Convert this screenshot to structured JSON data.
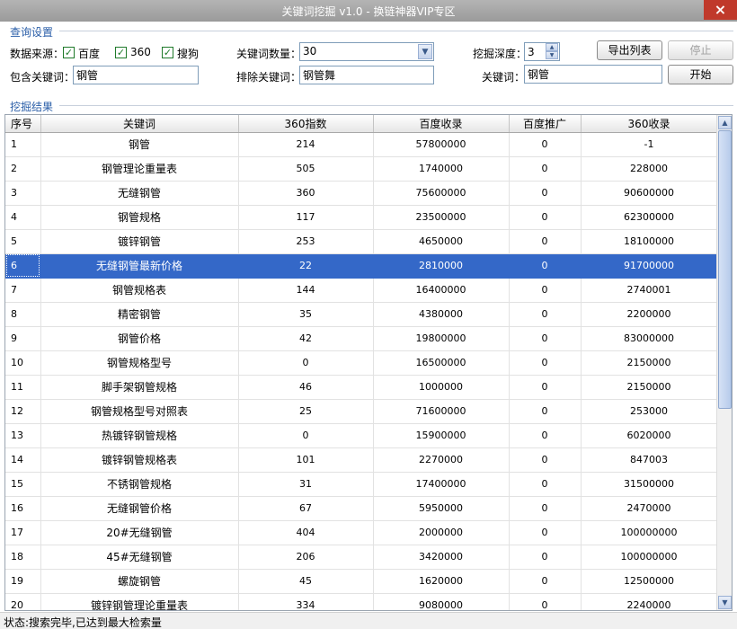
{
  "window": {
    "title": "关键词挖掘 v1.0 - 换链神器VIP专区",
    "close_glyph": "×"
  },
  "query": {
    "section_label": "查询设置",
    "source_label": "数据来源：",
    "sources": [
      {
        "label": "百度",
        "checked": true
      },
      {
        "label": "360",
        "checked": true
      },
      {
        "label": "搜狗",
        "checked": true
      }
    ],
    "check_glyph": "✓",
    "count_label": "关键词数量：",
    "count_value": "30",
    "depth_label": "挖掘深度：",
    "depth_value": "3",
    "include_label": "包含关键词：",
    "include_value": "钢管",
    "exclude_label": "排除关键词：",
    "exclude_value": "钢管舞",
    "keyword_label": "关键词：",
    "keyword_value": "钢管",
    "export_button": "导出列表",
    "stop_button": "停止",
    "start_button": "开始"
  },
  "results": {
    "section_label": "挖掘结果",
    "columns": [
      "序号",
      "关键词",
      "360指数",
      "百度收录",
      "百度推广",
      "360收录"
    ],
    "selected_index": 5,
    "rows": [
      [
        "1",
        "钢管",
        "214",
        "57800000",
        "0",
        "-1"
      ],
      [
        "2",
        "钢管理论重量表",
        "505",
        "1740000",
        "0",
        "228000"
      ],
      [
        "3",
        "无缝钢管",
        "360",
        "75600000",
        "0",
        "90600000"
      ],
      [
        "4",
        "钢管规格",
        "117",
        "23500000",
        "0",
        "62300000"
      ],
      [
        "5",
        "镀锌钢管",
        "253",
        "4650000",
        "0",
        "18100000"
      ],
      [
        "6",
        "无缝钢管最新价格",
        "22",
        "2810000",
        "0",
        "91700000"
      ],
      [
        "7",
        "钢管规格表",
        "144",
        "16400000",
        "0",
        "2740001"
      ],
      [
        "8",
        "精密钢管",
        "35",
        "4380000",
        "0",
        "2200000"
      ],
      [
        "9",
        "钢管价格",
        "42",
        "19800000",
        "0",
        "83000000"
      ],
      [
        "10",
        "钢管规格型号",
        "0",
        "16500000",
        "0",
        "2150000"
      ],
      [
        "11",
        "脚手架钢管规格",
        "46",
        "1000000",
        "0",
        "2150000"
      ],
      [
        "12",
        "钢管规格型号对照表",
        "25",
        "71600000",
        "0",
        "253000"
      ],
      [
        "13",
        "热镀锌钢管规格",
        "0",
        "15900000",
        "0",
        "6020000"
      ],
      [
        "14",
        "镀锌钢管规格表",
        "101",
        "2270000",
        "0",
        "847003"
      ],
      [
        "15",
        "不锈钢管规格",
        "31",
        "17400000",
        "0",
        "31500000"
      ],
      [
        "16",
        "无缝钢管价格",
        "67",
        "5950000",
        "0",
        "2470000"
      ],
      [
        "17",
        "20#无缝钢管",
        "404",
        "2000000",
        "0",
        "100000000"
      ],
      [
        "18",
        "45#无缝钢管",
        "206",
        "3420000",
        "0",
        "100000000"
      ],
      [
        "19",
        "螺旋钢管",
        "45",
        "1620000",
        "0",
        "12500000"
      ],
      [
        "20",
        "镀锌钢管理论重量表",
        "334",
        "9080000",
        "0",
        "2240000"
      ]
    ]
  },
  "status": {
    "text": "状态:搜索完毕,已达到最大检索量"
  },
  "icons": {
    "dropdown": "chevron-down-icon",
    "spin_up": "triangle-up-icon",
    "spin_down": "triangle-down-icon",
    "scroll_up": "scroll-up-icon",
    "scroll_down": "scroll-down-icon"
  },
  "colors": {
    "selected_row": "#3468c8",
    "section_label": "#2a5ea8",
    "close_button": "#c0392b",
    "checkbox": "#1f7a2a"
  },
  "scroll": {
    "thumb_fraction": 0.6,
    "position_fraction": 0
  }
}
